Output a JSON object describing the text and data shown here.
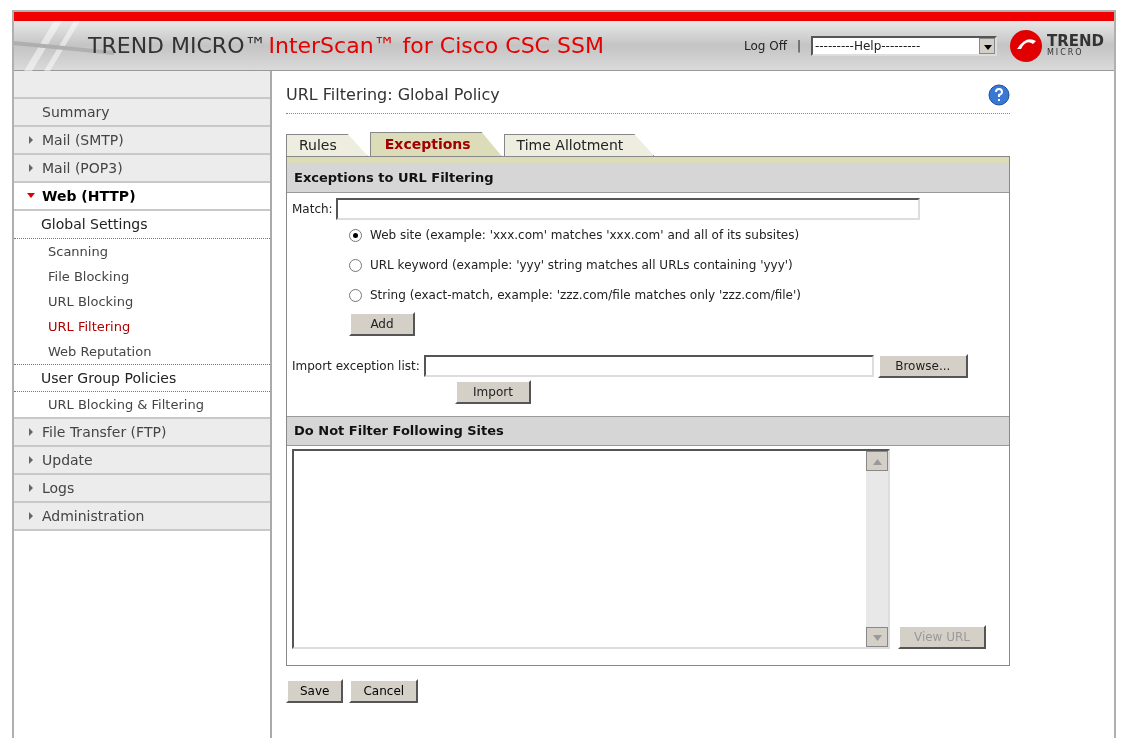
{
  "header": {
    "brand": "TREND MICRO™",
    "product": "InterScan™ for Cisco CSC SSM",
    "log_off": "Log Off",
    "separator": "|",
    "help_select": "---------Help---------",
    "logo_top": "TREND",
    "logo_bottom": "MICRO"
  },
  "sidebar": {
    "items": [
      {
        "label": "Summary",
        "kind": "link"
      },
      {
        "label": "Mail (SMTP)",
        "kind": "folder",
        "expanded": false
      },
      {
        "label": "Mail (POP3)",
        "kind": "folder",
        "expanded": false
      },
      {
        "label": "Web (HTTP)",
        "kind": "folder",
        "expanded": true,
        "children": [
          {
            "label": "Global Settings",
            "children": [
              {
                "label": "Scanning",
                "selected": false
              },
              {
                "label": "File Blocking",
                "selected": false
              },
              {
                "label": "URL Blocking",
                "selected": false
              },
              {
                "label": "URL Filtering",
                "selected": true
              },
              {
                "label": "Web Reputation",
                "selected": false
              }
            ]
          },
          {
            "label": "User Group Policies",
            "children": [
              {
                "label": "URL Blocking & Filtering",
                "selected": false
              }
            ]
          }
        ]
      },
      {
        "label": "File Transfer (FTP)",
        "kind": "folder",
        "expanded": false
      },
      {
        "label": "Update",
        "kind": "folder",
        "expanded": false
      },
      {
        "label": "Logs",
        "kind": "folder",
        "expanded": false
      },
      {
        "label": "Administration",
        "kind": "folder",
        "expanded": false
      }
    ]
  },
  "page_title": "URL Filtering: Global Policy",
  "tabs": [
    {
      "label": "Rules",
      "selected": false
    },
    {
      "label": "Exceptions",
      "selected": true
    },
    {
      "label": "Time Allotment",
      "selected": false
    }
  ],
  "exceptions": {
    "heading": "Exceptions to URL Filtering",
    "match_label": "Match:",
    "options": [
      {
        "label": "Web site (example: 'xxx.com' matches 'xxx.com' and all of its subsites)",
        "checked": true
      },
      {
        "label": "URL keyword (example: 'yyy' string matches all URLs containing 'yyy')",
        "checked": false
      },
      {
        "label": "String (exact-match, example: 'zzz.com/file matches only 'zzz.com/file')",
        "checked": false
      }
    ],
    "add_button": "Add",
    "import_label": "Import exception list:",
    "browse_button": "Browse...",
    "import_button": "Import"
  },
  "sites": {
    "heading": "Do Not Filter Following Sites",
    "view_button": {
      "label": "View URL",
      "disabled": true
    }
  },
  "buttons": [
    "Save",
    "Cancel"
  ]
}
